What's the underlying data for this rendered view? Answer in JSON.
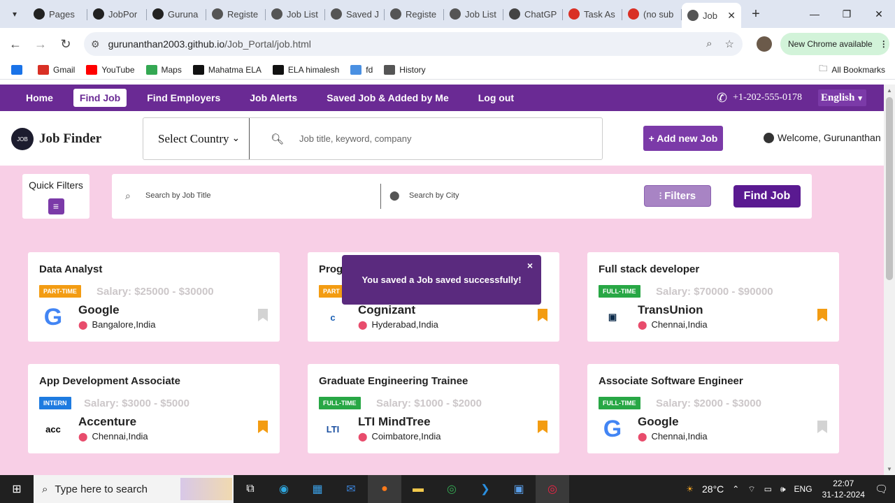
{
  "browser": {
    "tabs": [
      {
        "title": "Pages",
        "icon": "github-icon",
        "color": "#222"
      },
      {
        "title": "JobPor",
        "icon": "github-icon",
        "color": "#222"
      },
      {
        "title": "Guruna",
        "icon": "github-icon",
        "color": "#222"
      },
      {
        "title": "Registe",
        "icon": "globe-icon",
        "color": "#555"
      },
      {
        "title": "Job List",
        "icon": "globe-icon",
        "color": "#555"
      },
      {
        "title": "Saved J",
        "icon": "globe-icon",
        "color": "#555"
      },
      {
        "title": "Registe",
        "icon": "globe-icon",
        "color": "#555"
      },
      {
        "title": "Job List",
        "icon": "globe-icon",
        "color": "#555"
      },
      {
        "title": "ChatGP",
        "icon": "chatgpt-icon",
        "color": "#444"
      },
      {
        "title": "Task As",
        "icon": "gmail-icon",
        "color": "#d93025"
      },
      {
        "title": "(no sub",
        "icon": "gmail-icon",
        "color": "#d93025"
      },
      {
        "title": "Job",
        "icon": "globe-icon",
        "color": "#555",
        "active": true
      }
    ],
    "url_host": "gurunanthan2003.github.io",
    "url_path": "/Job_Portal/job.html",
    "update_label": "New Chrome available",
    "bookmarks": [
      {
        "label": "Gmail",
        "color": "#d93025"
      },
      {
        "label": "YouTube",
        "color": "#ff0000"
      },
      {
        "label": "Maps",
        "color": "#34a853"
      },
      {
        "label": "Mahatma ELA",
        "color": "#111"
      },
      {
        "label": "ELA himalesh",
        "color": "#111"
      },
      {
        "label": "fd",
        "color": "#4a90e2"
      },
      {
        "label": "History",
        "color": "#555"
      }
    ],
    "all_bookmarks": "All Bookmarks"
  },
  "nav": {
    "links": [
      "Home",
      "Find Job",
      "Find Employers",
      "Job Alerts",
      "Saved Job & Added by Me",
      "Log out"
    ],
    "current": "Find Job",
    "phone": "+1-202-555-0178",
    "language": "English"
  },
  "header": {
    "brand": "Job Finder",
    "country": "Select Country",
    "search_placeholder": "Job title, keyword, company",
    "add_job": "+ Add new Job",
    "welcome": "Welcome, Gurunanthan"
  },
  "filters": {
    "quick_label": "Quick Filters",
    "title_placeholder": "Search by Job Title",
    "city_placeholder": "Search by City",
    "filters_button": "Filters",
    "find_button": "Find Job"
  },
  "toast": {
    "message_pre": "You saved a ",
    "message_bold": "Job saved successfully!",
    "close": "×"
  },
  "jobs": [
    {
      "title": "Data Analyst",
      "type": "PART-TIME",
      "type_color": "#f39c12",
      "salary": "Salary: $25000 - $30000",
      "company": "Google",
      "location": "Bangalore,India",
      "logo": "google-logo",
      "saved": false
    },
    {
      "title": "Prog",
      "type": "PART",
      "type_color": "#f39c12",
      "salary": "",
      "company": "Cognizant",
      "location": "Hyderabad,India",
      "logo": "cognizant-logo",
      "saved": true
    },
    {
      "title": "Full stack developer",
      "type": "FULL-TIME",
      "type_color": "#28a745",
      "salary": "Salary: $70000 - $90000",
      "company": "TransUnion",
      "location": "Chennai,India",
      "logo": "transunion-logo",
      "saved": true
    },
    {
      "title": "App Development Associate",
      "type": "INTERN",
      "type_color": "#1e7be0",
      "salary": "Salary: $3000 - $5000",
      "company": "Accenture",
      "location": "Chennai,India",
      "logo": "accenture-logo",
      "saved": true
    },
    {
      "title": "Graduate Engineering Trainee",
      "type": "FULL-TIME",
      "type_color": "#28a745",
      "salary": "Salary: $1000 - $2000",
      "company": "LTI MindTree",
      "location": "Coimbatore,India",
      "logo": "ltimindtree-logo",
      "saved": true
    },
    {
      "title": "Associate Software Engineer",
      "type": "FULL-TIME",
      "type_color": "#28a745",
      "salary": "Salary: $2000 - $3000",
      "company": "Google",
      "location": "Chennai,India",
      "logo": "google-logo",
      "saved": false
    }
  ],
  "taskbar": {
    "search_placeholder": "Type here to search",
    "temperature": "28°C",
    "lang": "ENG",
    "time": "22:07",
    "date": "31-12-2024",
    "notifications": "1"
  }
}
